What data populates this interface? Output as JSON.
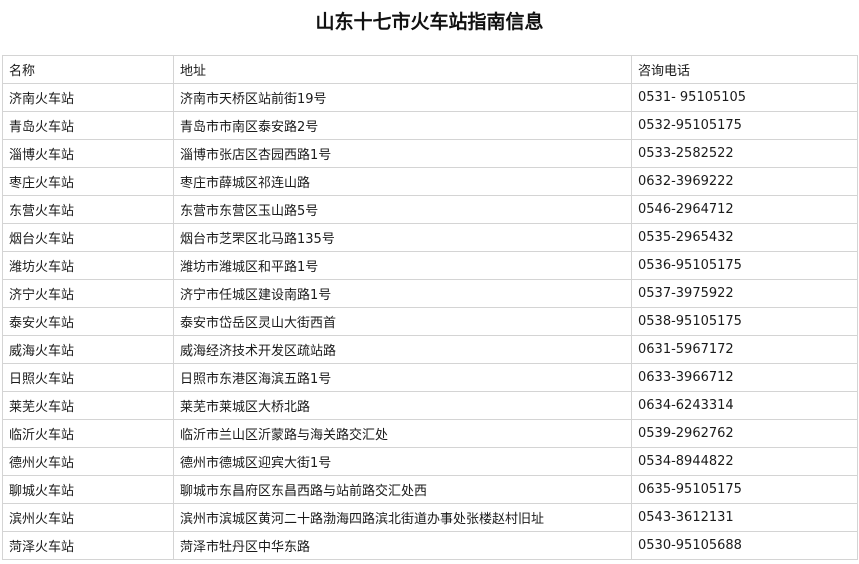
{
  "title": "山东十七市火车站指南信息",
  "columns": [
    "名称",
    "地址",
    "咨询电话"
  ],
  "rows": [
    [
      "济南火车站",
      "济南市天桥区站前街19号",
      "0531- 95105105"
    ],
    [
      "青岛火车站",
      "青岛市市南区泰安路2号",
      "0532-95105175"
    ],
    [
      "淄博火车站",
      "淄博市张店区杏园西路1号",
      "0533-2582522"
    ],
    [
      "枣庄火车站",
      "枣庄市薛城区祁连山路",
      "0632-3969222"
    ],
    [
      "东营火车站",
      "东营市东营区玉山路5号",
      "0546-2964712"
    ],
    [
      "烟台火车站",
      "烟台市芝罘区北马路135号",
      "0535-2965432"
    ],
    [
      "潍坊火车站",
      "潍坊市潍城区和平路1号",
      "0536-95105175"
    ],
    [
      "济宁火车站",
      "济宁市任城区建设南路1号",
      "0537-3975922"
    ],
    [
      "泰安火车站",
      "泰安市岱岳区灵山大街西首",
      "0538-95105175"
    ],
    [
      "威海火车站",
      "威海经济技术开发区疏站路",
      "0631-5967172"
    ],
    [
      "日照火车站",
      "日照市东港区海滨五路1号",
      "0633-3966712"
    ],
    [
      "莱芜火车站",
      "莱芜市莱城区大桥北路",
      "0634-6243314"
    ],
    [
      "临沂火车站",
      "临沂市兰山区沂蒙路与海关路交汇处",
      "0539-2962762"
    ],
    [
      "德州火车站",
      "德州市德城区迎宾大街1号",
      "0534-8944822"
    ],
    [
      "聊城火车站",
      "聊城市东昌府区东昌西路与站前路交汇处西",
      "0635-95105175"
    ],
    [
      "滨州火车站",
      "滨州市滨城区黄河二十路渤海四路滨北街道办事处张楼赵村旧址",
      "0543-3612131"
    ],
    [
      "菏泽火车站",
      "菏泽市牡丹区中华东路",
      "0530-95105688"
    ]
  ]
}
